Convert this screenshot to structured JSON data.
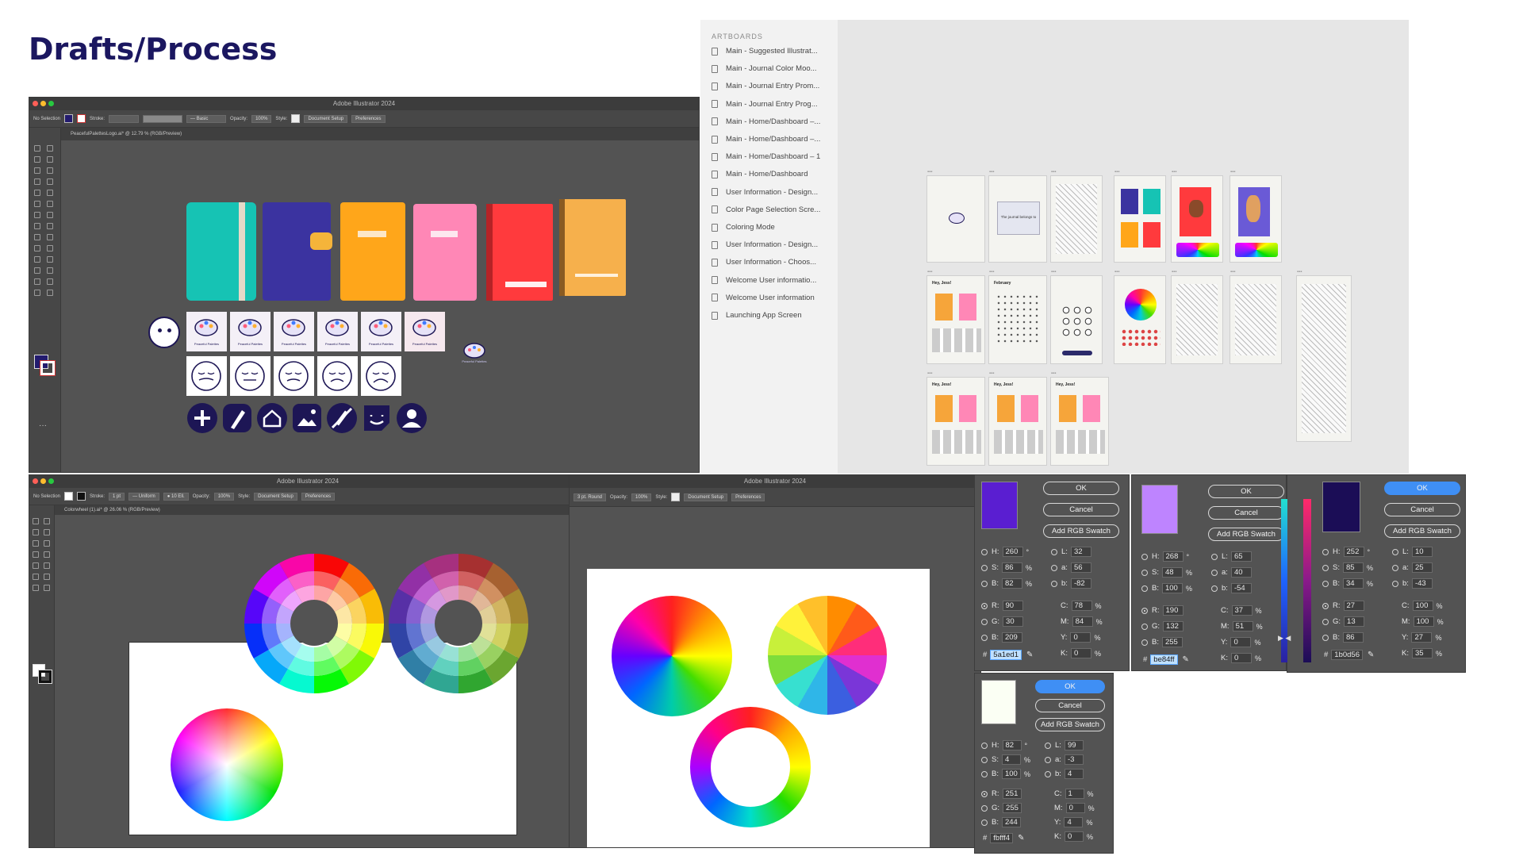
{
  "page": {
    "title": "Drafts/Process"
  },
  "illustrator": {
    "app_title": "Adobe Illustrator 2024",
    "top": {
      "selection": "No Selection",
      "stroke_label": "Stroke:",
      "brush": "Basic",
      "opacity_label": "Opacity:",
      "opacity": "100%",
      "style_label": "Style:",
      "doc_setup": "Document Setup",
      "preferences": "Preferences",
      "tab": "PeacefulPalettesLogo.ai* @ 12.79 % (RGB/Preview)",
      "fill_color": "#231b6e"
    },
    "bottom_left": {
      "selection": "No Selection",
      "stroke_label": "Stroke:",
      "stroke_weight": "1 pt",
      "profile": "Uniform",
      "brush": "10 Ell.",
      "opacity_label": "Opacity:",
      "opacity": "100%",
      "style_label": "Style:",
      "doc_setup": "Document Setup",
      "preferences": "Preferences",
      "tab": "Colorwheel (1).ai* @ 26.06 % (RGB/Preview)"
    },
    "bottom_mid": {
      "stroke_brush": "3 pt. Round",
      "opacity_label": "Opacity:",
      "opacity": "100%",
      "style_label": "Style:",
      "doc_setup": "Document Setup",
      "preferences": "Preferences"
    }
  },
  "notebooks": {
    "colors": [
      "#16c3b4",
      "#3b33a0",
      "#ffa61a",
      "#ff87b6",
      "#ff3a3d",
      "#f6b04c"
    ],
    "logo_caption": "Peaceful Palettes",
    "icons": [
      "plus-icon",
      "brush-icon",
      "home-icon",
      "image-icon",
      "no-draw-icon",
      "sticker-icon",
      "user-icon"
    ],
    "icon_color": "#1d1655"
  },
  "artboards": {
    "header": "ARTBOARDS",
    "items": [
      "Main - Suggested Illustrat...",
      "Main - Journal Color Moo...",
      "Main - Journal Entry Prom...",
      "Main - Journal Entry Prog...",
      "Main - Home/Dashboard –...",
      "Main - Home/Dashboard –...",
      "Main - Home/Dashboard – 1",
      "Main - Home/Dashboard",
      "User Information - Design...",
      "Color Page Selection Scre...",
      "Coloring Mode",
      "User Information - Design...",
      "User Information - Choos...",
      "Welcome User informatio...",
      "Welcome User information",
      "Launching App Screen"
    ],
    "thumb_texts": {
      "journal_prompt": "The journal belongs to",
      "home_greeting": "Hey, Jess!",
      "month": "February"
    }
  },
  "color_pickers": [
    {
      "swatch": "#5a1ed1",
      "ok": "OK",
      "cancel": "Cancel",
      "add": "Add RGB Swatch",
      "H": "260",
      "S": "86",
      "B": "82",
      "R": "90",
      "G": "30",
      "Bv": "209",
      "L": "32",
      "a": "56",
      "b": "-82",
      "C": "78",
      "M": "84",
      "Y": "0",
      "K": "0",
      "hex": "5a1ed1",
      "hex_selected": true
    },
    {
      "swatch": "#be84ff",
      "ok": "OK",
      "cancel": "Cancel",
      "add": "Add RGB Swatch",
      "H": "268",
      "S": "48",
      "B": "100",
      "R": "190",
      "G": "132",
      "Bv": "255",
      "L": "65",
      "a": "40",
      "b": "-54",
      "C": "37",
      "M": "51",
      "Y": "0",
      "K": "0",
      "hex": "be84ff",
      "hex_selected": true
    },
    {
      "swatch": "#1b0d56",
      "ok": "OK",
      "cancel": "Cancel",
      "add": "Add RGB Swatch",
      "H": "252",
      "S": "85",
      "B": "34",
      "R": "27",
      "G": "13",
      "Bv": "86",
      "L": "10",
      "a": "25",
      "b": "-43",
      "C": "100",
      "M": "100",
      "Y": "27",
      "K": "35",
      "hex": "1b0d56",
      "hex_selected": false
    },
    {
      "swatch": "#fbfff4",
      "ok": "OK",
      "cancel": "Cancel",
      "add": "Add RGB Swatch",
      "H": "82",
      "S": "4",
      "B": "100",
      "R": "251",
      "G": "255",
      "Bv": "244",
      "L": "99",
      "a": "-3",
      "b": "4",
      "C": "1",
      "M": "0",
      "Y": "4",
      "K": "0",
      "hex": "fbfff4",
      "hex_selected": false
    }
  ]
}
